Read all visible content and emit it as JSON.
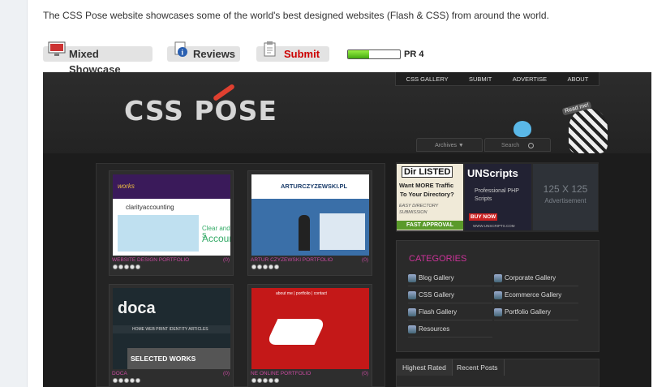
{
  "intro": "The CSS Pose website showcases some of the world's best designed websites (Flash & CSS) from around the world.",
  "actions": {
    "mixed_showcase": "Mixed Showcase",
    "reviews": "Reviews",
    "submit": "Submit",
    "pagerank": {
      "label": "PR 4",
      "value": 4,
      "max": 10
    }
  },
  "site": {
    "logo": "CSS POSE",
    "nav": [
      "CSS GALLERY",
      "SUBMIT",
      "ADVERTISE",
      "ABOUT"
    ],
    "archives": "Archives ▼",
    "search": "Search",
    "read_me": "Read me!",
    "cards": [
      {
        "title": "WEBSITE DESIGN PORTFOLIO",
        "count": "(0)",
        "rating": 5
      },
      {
        "title": "ARTUR CZYZEWSKI PORTFOLIO",
        "count": "(0)",
        "rating": 5
      },
      {
        "title": "DOCA",
        "count": "(0)",
        "rating": 5
      },
      {
        "title": "NE ONLINE PORTFOLIO",
        "count": "(0)",
        "rating": 5
      }
    ],
    "thumbs": {
      "works": "works",
      "clarity": "clarityaccounting",
      "clear": "Clear and S",
      "accoun": "Accoun",
      "artur": "ARTURCZYZEWSKI.PL",
      "doca": "doca",
      "doca_nav": "HOME   WEB   PRINT   IDENTITY   ARTICLES",
      "selected_works": "SELECTED WORKS",
      "ne_nav": "about me  |  portfolio  |  contact"
    },
    "ads": {
      "ad1_title": "Dir LISTED",
      "ad1_line1": "Want MORE Traffic",
      "ad1_line2": "To Your Directory?",
      "ad1_line3": "EASY DIRECTORY",
      "ad1_line4": "SUBMISSION",
      "ad1_cta": "FAST APPROVAL",
      "ad2_title": "UNScripts",
      "ad2_line1": "Professional PHP",
      "ad2_line2": "Scripts",
      "ad2_cta": "BUY NOW",
      "ad2_url": "WWW.UNSCRIPTS.COM",
      "ad3_size": "125 X 125",
      "ad3_label": "Advertisement"
    },
    "categories_title": "CATEGORIES",
    "categories": [
      "Blog Gallery",
      "Corporate Gallery",
      "CSS Gallery",
      "Ecommerce Gallery",
      "Flash Gallery",
      "Portfolio Gallery",
      "Resources"
    ],
    "tabs": [
      "Highest Rated",
      "Recent Posts"
    ]
  }
}
